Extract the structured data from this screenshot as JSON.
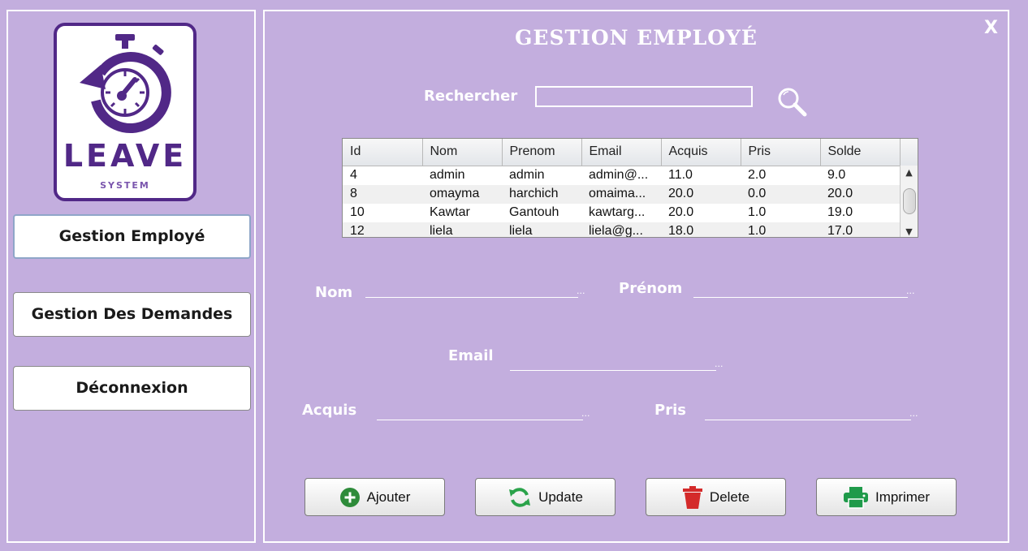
{
  "logo": {
    "word": "LEAVE",
    "sub": "SYSTEM"
  },
  "sidebar": {
    "items": [
      {
        "label": "Gestion Employé",
        "active": true
      },
      {
        "label": "Gestion Des Demandes",
        "active": false
      },
      {
        "label": "Déconnexion",
        "active": false
      }
    ]
  },
  "header": {
    "title": "GESTION EMPLOYÉ",
    "close_label": "X"
  },
  "search": {
    "label": "Rechercher",
    "value": "",
    "icon": "search-icon"
  },
  "table": {
    "columns": [
      "Id",
      "Nom",
      "Prenom",
      "Email",
      "Acquis",
      "Pris",
      "Solde"
    ],
    "rows": [
      [
        "4",
        "admin",
        "admin",
        "admin@...",
        "11.0",
        "2.0",
        "9.0"
      ],
      [
        "8",
        "omayma",
        "harchich",
        "omaima...",
        "20.0",
        "0.0",
        "20.0"
      ],
      [
        "10",
        "Kawtar",
        "Gantouh",
        "kawtarg...",
        "20.0",
        "1.0",
        "19.0"
      ],
      [
        "12",
        "liela",
        "liela",
        "liela@g...",
        "18.0",
        "1.0",
        "17.0"
      ]
    ]
  },
  "form": {
    "nom_label": "Nom",
    "prenom_label": "Prénom",
    "email_label": "Email",
    "acquis_label": "Acquis",
    "pris_label": "Pris",
    "ellipsis": "..."
  },
  "actions": {
    "add_label": "Ajouter",
    "update_label": "Update",
    "delete_label": "Delete",
    "print_label": "Imprimer"
  },
  "colors": {
    "background": "#c3aede",
    "brand_purple": "#512887",
    "add_green": "#2e8b3a",
    "update_green": "#2aa34a",
    "delete_red": "#d42a2a",
    "print_green": "#1f9a4a"
  }
}
